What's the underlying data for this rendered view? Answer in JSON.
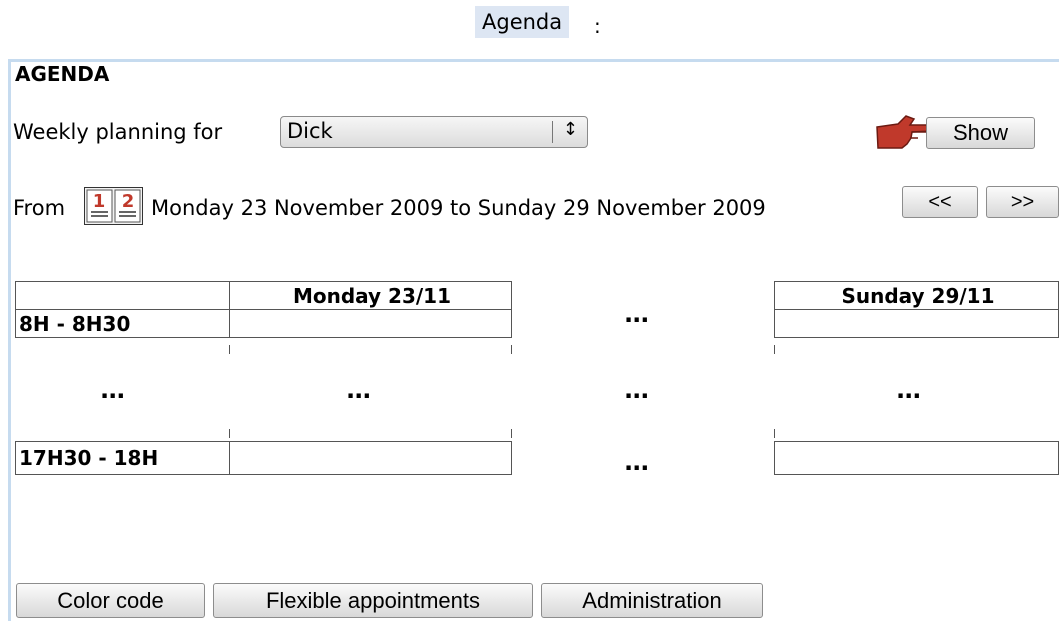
{
  "header": {
    "title": "Agenda",
    "colon": ":"
  },
  "agenda": {
    "heading": "AGENDA",
    "planning_label": "Weekly planning for",
    "selected_person": "Dick",
    "select_arrows": "↕",
    "show_button": "Show",
    "from_label": "From",
    "calendar_icon_digits": [
      "1",
      "2"
    ],
    "date_range": "Monday 23 November 2009 to Sunday 29 November 2009",
    "prev_button": "<<",
    "next_button": ">>"
  },
  "grid": {
    "first_day": "Monday 23/11",
    "last_day": "Sunday 29/11",
    "first_slot": "8H - 8H30",
    "last_slot": "17H30 - 18H",
    "ellipsis": "..."
  },
  "bottom_buttons": {
    "color_code": "Color code",
    "flexible": "Flexible appointments",
    "administration": "Administration"
  },
  "colors": {
    "frame": "#c6dbef",
    "title_bg": "#dde6f3",
    "pointer": "#c0392b"
  }
}
